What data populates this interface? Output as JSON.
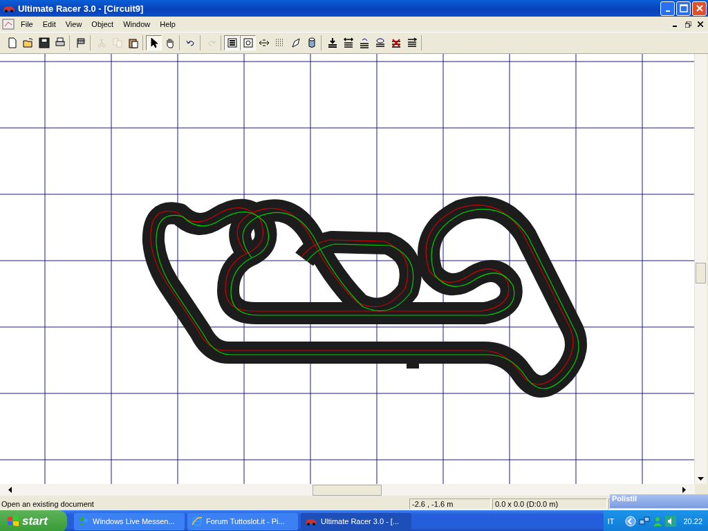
{
  "window": {
    "title": "Ultimate Racer 3.0 - [Circuit9]"
  },
  "menu": [
    {
      "label": "File"
    },
    {
      "label": "Edit"
    },
    {
      "label": "View"
    },
    {
      "label": "Object"
    },
    {
      "label": "Window"
    },
    {
      "label": "Help"
    }
  ],
  "toolbar": [
    [
      {
        "kind": "new",
        "disabled": false,
        "pressed": false
      },
      {
        "kind": "open",
        "disabled": false,
        "pressed": false
      },
      {
        "kind": "save",
        "disabled": false,
        "pressed": false
      },
      {
        "kind": "print",
        "disabled": false,
        "pressed": false
      }
    ],
    [
      {
        "kind": "flag",
        "disabled": false,
        "pressed": false
      }
    ],
    [
      {
        "kind": "cut",
        "disabled": true,
        "pressed": false
      },
      {
        "kind": "copy",
        "disabled": true,
        "pressed": false
      },
      {
        "kind": "paste",
        "disabled": false,
        "pressed": false
      }
    ],
    [
      {
        "kind": "pointer",
        "disabled": false,
        "pressed": true
      },
      {
        "kind": "hand",
        "disabled": false,
        "pressed": false
      }
    ],
    [
      {
        "kind": "undo",
        "disabled": false,
        "pressed": false
      }
    ],
    [
      {
        "kind": "redo",
        "disabled": true,
        "pressed": false
      }
    ],
    [
      {
        "kind": "layers",
        "disabled": false,
        "pressed": true
      },
      {
        "kind": "picture",
        "disabled": false,
        "pressed": true
      },
      {
        "kind": "swap",
        "disabled": false,
        "pressed": false
      },
      {
        "kind": "grid",
        "disabled": false,
        "pressed": false
      },
      {
        "kind": "eraser",
        "disabled": false,
        "pressed": false
      },
      {
        "kind": "cylinder",
        "disabled": false,
        "pressed": false
      }
    ],
    [
      {
        "kind": "lane-in",
        "disabled": false,
        "pressed": false
      },
      {
        "kind": "lane-swap",
        "disabled": false,
        "pressed": false
      },
      {
        "kind": "lane-back",
        "disabled": false,
        "pressed": false
      },
      {
        "kind": "lane-loop",
        "disabled": false,
        "pressed": false
      },
      {
        "kind": "lane-delete",
        "disabled": false,
        "pressed": false
      },
      {
        "kind": "lane-out",
        "disabled": false,
        "pressed": false
      }
    ]
  ],
  "status_bar": {
    "message": "Open an existing document",
    "coordinates": "-2.6 , -1.6 m",
    "size": "0.0 x 0.0  (D:0.0 m)"
  },
  "floating_palette": {
    "title": "Polistil"
  },
  "taskbar": {
    "start": "start",
    "tasks": [
      {
        "label": "Windows Live Messen...",
        "selected": false
      },
      {
        "label": "Forum Tuttoslot.it - Pi...",
        "selected": false
      },
      {
        "label": "Ultimate Racer 3.0 - [...",
        "selected": true
      }
    ],
    "language": "IT",
    "clock": "20.22"
  }
}
